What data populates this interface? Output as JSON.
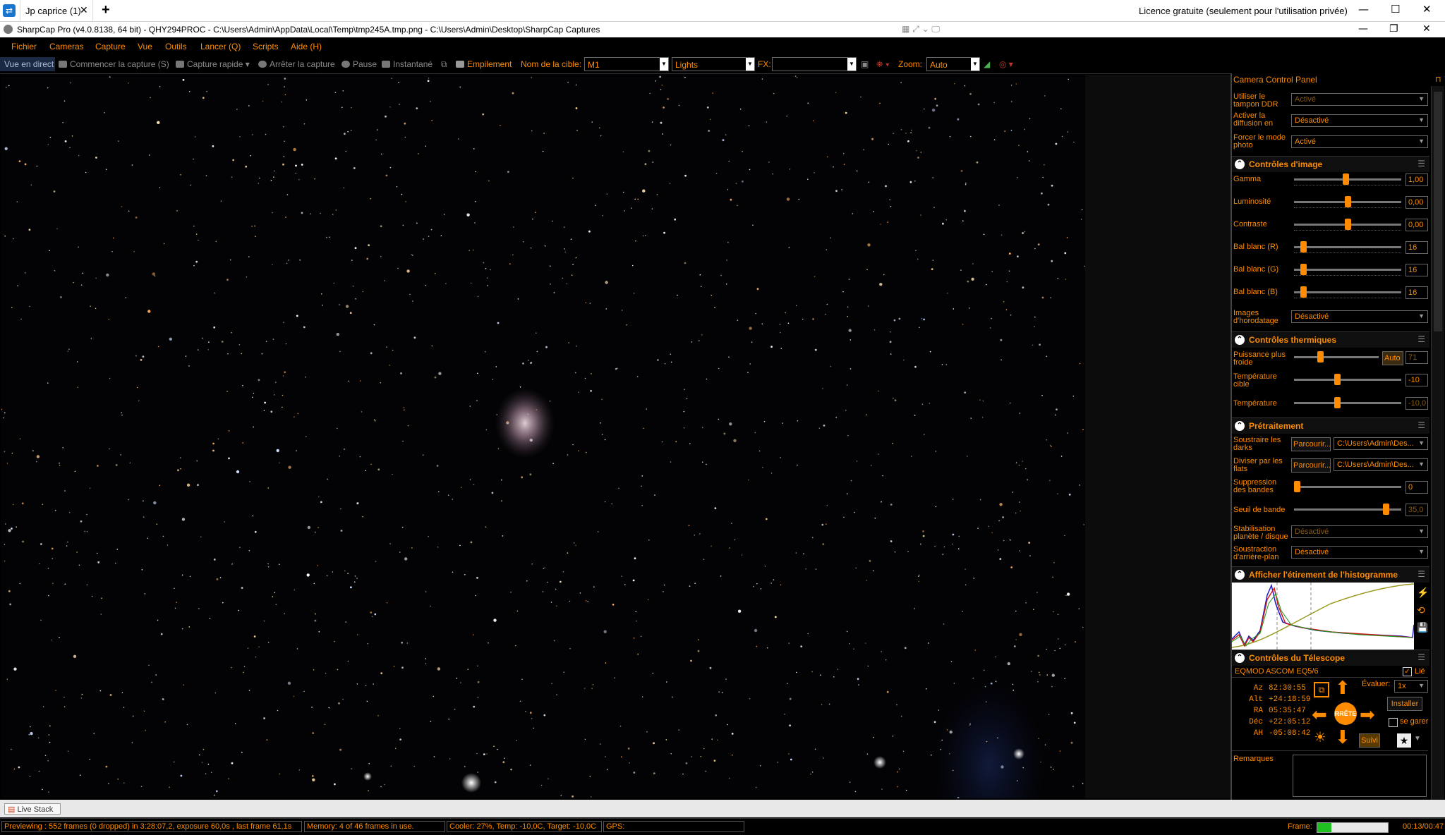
{
  "remote_app": {
    "tab_label": "Jp caprice (1)",
    "license_text": "Licence gratuite (seulement pour l'utilisation privée)"
  },
  "window": {
    "title": "SharpCap Pro (v4.0.8138, 64 bit) - QHY294PROC - C:\\Users\\Admin\\AppData\\Local\\Temp\\tmp245A.tmp.png - C:\\Users\\Admin\\Desktop\\SharpCap Captures"
  },
  "menu": [
    "Fichier",
    "Cameras",
    "Capture",
    "Vue",
    "Outils",
    "Lancer (Q)",
    "Scripts",
    "Aide (H)"
  ],
  "toolbar": {
    "live_view": "Vue en direct",
    "start_capture": "Commencer la capture (S)",
    "quick_capture": "Capture rapide",
    "stop_capture": "Arrêter la capture",
    "pause": "Pause",
    "snapshot": "Instantané",
    "stacking": "Empilement",
    "target_label": "Nom de la cible:",
    "target_value": "M1",
    "frame_type": "Lights",
    "fx_label": "FX:",
    "zoom_label": "Zoom:",
    "zoom_value": "Auto"
  },
  "panel": {
    "title": "Camera Control Panel",
    "top_rows": [
      {
        "label": "Utiliser le tampon DDR",
        "value": "Activé"
      },
      {
        "label": "Activer la diffusion en direct",
        "value": "Désactivé"
      },
      {
        "label": "Forcer le mode photo",
        "value": "Activé"
      }
    ],
    "image_controls": {
      "header": "Contrôles d'image",
      "rows": [
        {
          "label": "Gamma",
          "value": "1,00",
          "pos": 0.48
        },
        {
          "label": "Luminosité",
          "value": "0,00",
          "pos": 0.5
        },
        {
          "label": "Contraste",
          "value": "0,00",
          "pos": 0.5
        },
        {
          "label": "Bal blanc (R)",
          "value": "16",
          "pos": 0.06
        },
        {
          "label": "Bal blanc (G)",
          "value": "16",
          "pos": 0.06
        },
        {
          "label": "Bal blanc (B)",
          "value": "16",
          "pos": 0.06
        }
      ],
      "timestamp_label": "Images d'horodatage",
      "timestamp_value": "Désactivé"
    },
    "thermal": {
      "header": "Contrôles thermiques",
      "cooler_label": "Puissance plus froide",
      "cooler_auto": "Auto",
      "cooler_value": "71",
      "cooler_pos": 0.3,
      "target_label": "Température cible",
      "target_value": "-10",
      "target_pos": 0.4,
      "temp_label": "Température",
      "temp_value": "-10,0",
      "temp_pos": 0.4
    },
    "preprocessing": {
      "header": "Prétraitement",
      "darks_label": "Soustraire les darks",
      "darks_browse": "Parcourir...",
      "darks_path": "C:\\Users\\Admin\\Des...",
      "flats_label": "Diviser par les flats",
      "flats_browse": "Parcourir...",
      "flats_path": "C:\\Users\\Admin\\Des...",
      "banding_label": "Suppression des bandes",
      "banding_value": "0",
      "banding_pos": 0.0,
      "threshold_label": "Seuil de bande",
      "threshold_value": "35,0",
      "threshold_pos": 0.88,
      "stabilization_label": "Stabilisation planète / disque",
      "stabilization_value": "Désactivé",
      "background_label": "Soustraction d'arrière-plan",
      "background_value": "Désactivé"
    },
    "histogram": {
      "header": "Afficher l'étirement de l'histogramme"
    },
    "telescope": {
      "header": "Contrôles du Télescope",
      "mount": "EQMOD ASCOM EQ5/6",
      "linked_label": "Lié",
      "coords": [
        {
          "label": "Az",
          "value": "82:30:55"
        },
        {
          "label": "Alt",
          "value": "+24:18:59"
        },
        {
          "label": "RA",
          "value": "05:35:47"
        },
        {
          "label": "Déc",
          "value": "+22:05:12"
        },
        {
          "label": "AH",
          "value": "-05:08:42"
        }
      ],
      "stop_label": "RRÊTE",
      "rate_label": "Évaluer:",
      "rate_value": "1x",
      "install_label": "Installer",
      "park_label": "se garer",
      "track_label": "Suivi"
    },
    "notes_label": "Remarques"
  },
  "live_stack_tab": "Live Stack",
  "status": {
    "previewing": "Previewing : 552 frames (0 dropped) in 3:28:07,2, exposure 60,0s , last frame 61,1s",
    "memory": "Memory: 4 of 46 frames in use.",
    "cooler": "Cooler: 27%, Temp: -10,0C, Target: -10,0C",
    "gps": "GPS:",
    "frame_label": "Frame:",
    "frame_progress": 0.2,
    "elapsed": "00:13/00:47"
  }
}
